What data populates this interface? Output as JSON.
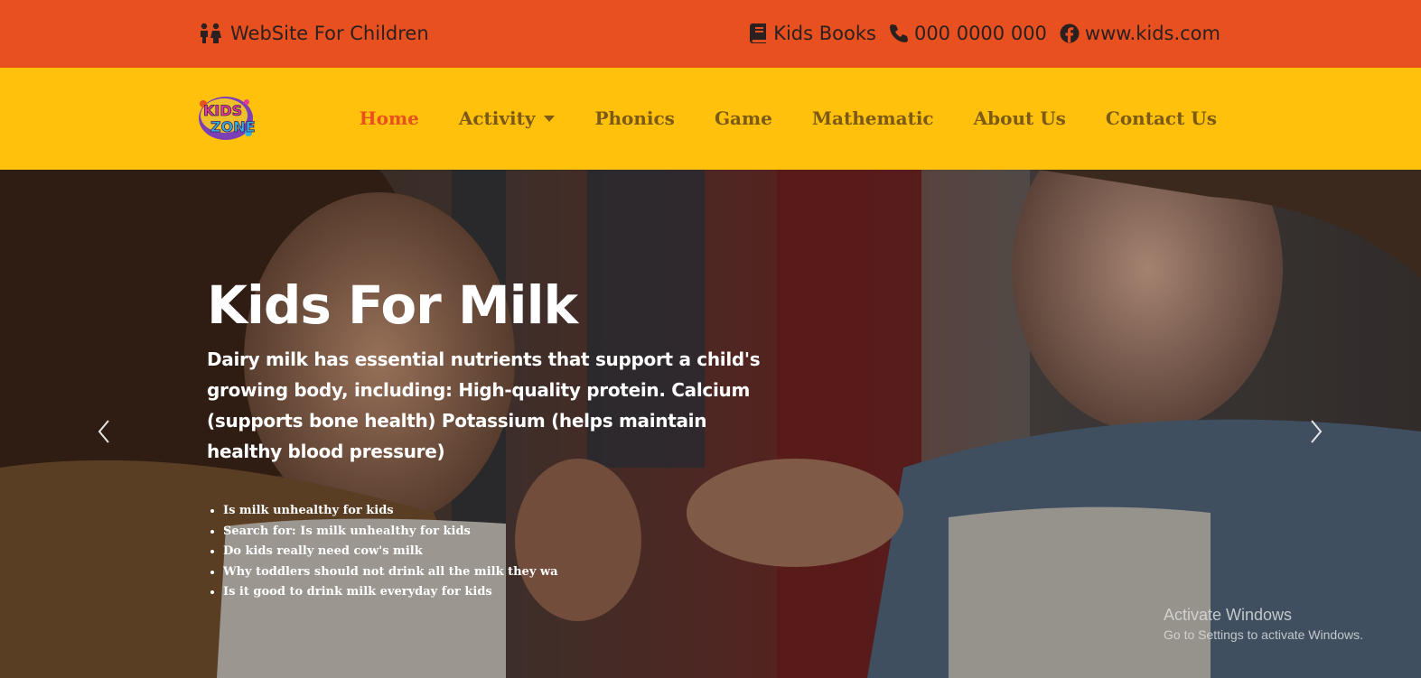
{
  "topbar": {
    "site_title": "WebSite For Children",
    "books": "Kids Books",
    "phone": "000 0000 000",
    "website": "www.kids.com",
    "background": "#e8511f"
  },
  "navbar": {
    "background": "#ffc10b",
    "logo_text": "KIDS ZONE",
    "items": [
      {
        "label": "Home",
        "active": true
      },
      {
        "label": "Activity",
        "dropdown": true
      },
      {
        "label": "Phonics"
      },
      {
        "label": "Game"
      },
      {
        "label": "Mathematic"
      },
      {
        "label": "About Us"
      },
      {
        "label": "Contact Us"
      }
    ],
    "active_color": "#e8511f",
    "text_color": "#7a5a16"
  },
  "hero": {
    "title": "Kids For Milk",
    "lead": "Dairy milk has essential nutrients that support a child's growing body, including: High-quality protein. Calcium (supports bone health) Potassium (helps maintain healthy blood pressure)",
    "bullets": [
      "Is milk unhealthy for kids",
      "Search for: Is milk unhealthy for kids",
      "Do kids really need cow's milk",
      "Why toddlers should not drink all the milk they wa",
      "Is it good to drink milk everyday for kids"
    ],
    "prev_icon": "chevron-left-icon",
    "next_icon": "chevron-right-icon"
  },
  "watermark": {
    "line1": "Activate Windows",
    "line2": "Go to Settings to activate Windows."
  }
}
